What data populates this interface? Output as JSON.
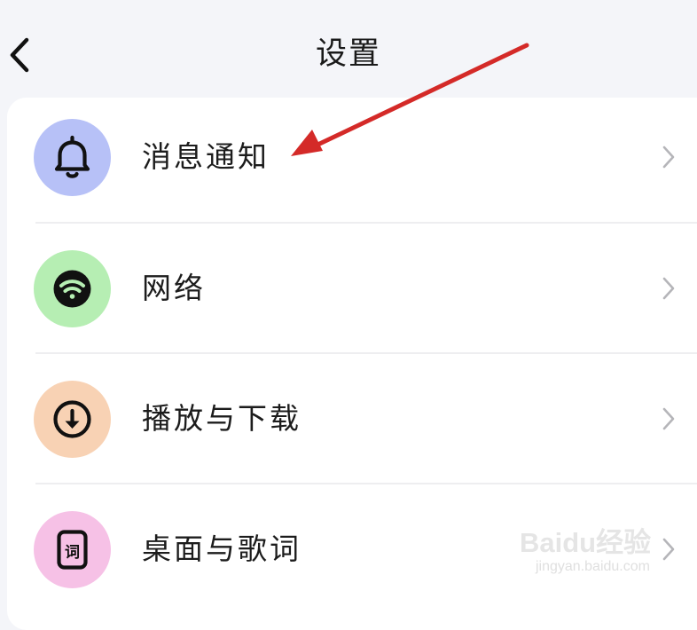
{
  "header": {
    "title": "设置",
    "back_icon": "chevron-left-icon"
  },
  "settings": {
    "items": [
      {
        "label": "消息通知",
        "icon": "bell-icon",
        "icon_bg": "#b7c1f7"
      },
      {
        "label": "网络",
        "icon": "wifi-icon",
        "icon_bg": "#b6eeb3"
      },
      {
        "label": "播放与下载",
        "icon": "download-icon",
        "icon_bg": "#f8d2b4"
      },
      {
        "label": "桌面与歌词",
        "icon": "lyrics-widget-icon",
        "icon_bg": "#f6c1e6",
        "icon_text": "词"
      }
    ]
  },
  "annotation": {
    "arrow_color": "#d42a28"
  },
  "watermark": {
    "logo_text": "Baidu经验",
    "url_text": "jingyan.baidu.com"
  }
}
